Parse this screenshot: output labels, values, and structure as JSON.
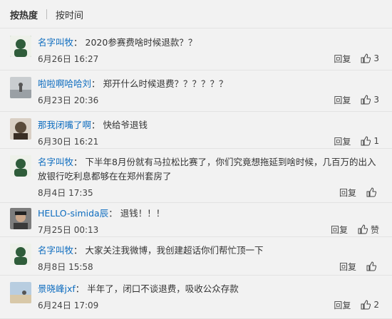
{
  "sort": {
    "hot": "按热度",
    "time": "按时间"
  },
  "reply_label": "回复",
  "comments": [
    {
      "user": "名字叫牧",
      "text": "2020参赛费啥时候退款？？",
      "time": "6月26日 16:27",
      "likes": "3",
      "avatar_color": "#2f5d3a"
    },
    {
      "user": "啦啦啊哈哈刘",
      "text": "郑开什么时候退费？？？？？？",
      "time": "6月23日 20:36",
      "likes": "3",
      "avatar_color": "#9aa0a5"
    },
    {
      "user": "那我闭嘴了啊",
      "text": "快给爷退钱",
      "time": "6月30日 16:21",
      "likes": "1",
      "avatar_color": "#5a4a3a"
    },
    {
      "user": "名字叫牧",
      "text": "下半年8月份就有马拉松比赛了，你们究竟想拖延到啥时候，几百万的出入放银行吃利息都够在在郑州套房了",
      "time": "8月4日 17:35",
      "likes": "",
      "avatar_color": "#2f5d3a"
    },
    {
      "user": "HELLO-simida辰",
      "text": "退钱！！！",
      "time": "7月25日 00:13",
      "likes": "赞",
      "avatar_color": "#3a3a3a"
    },
    {
      "user": "名字叫牧",
      "text": "大家关注我微博，我创建超话你们帮忙顶一下",
      "time": "8月8日 15:58",
      "likes": "",
      "avatar_color": "#2f5d3a"
    },
    {
      "user": "景晓峰jxf",
      "text": "半年了，闭口不谈退费，吸收公众存款",
      "time": "6月24日 17:09",
      "likes": "2",
      "avatar_color": "#8aa8c8"
    }
  ]
}
